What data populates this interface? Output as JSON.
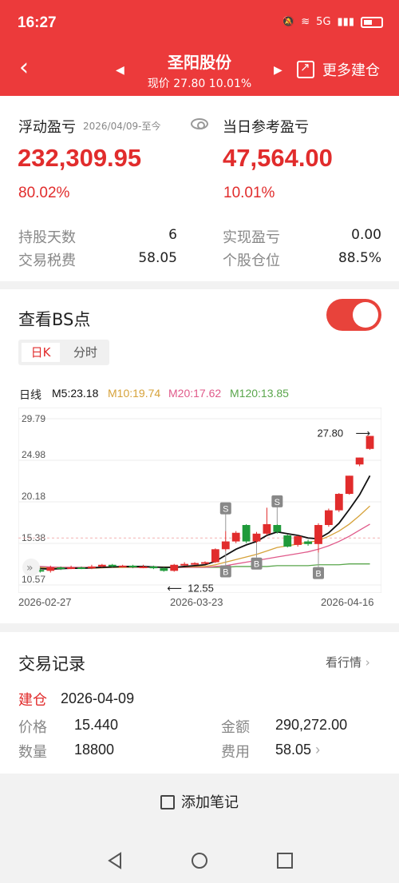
{
  "status_bar": {
    "time": "16:27",
    "network": "5G"
  },
  "header": {
    "title": "圣阳股份",
    "subtitle": "现价 27.80 10.01%",
    "more_label": "更多建仓"
  },
  "summary": {
    "float_label": "浮动盈亏",
    "float_date": "2026/04/09-至今",
    "float_value": "232,309.95",
    "float_pct": "80.02%",
    "day_label": "当日参考盈亏",
    "day_value": "47,564.00",
    "day_pct": "10.01%",
    "hold_days_label": "持股天数",
    "hold_days": "6",
    "realized_label": "实现盈亏",
    "realized": "0.00",
    "fee_label": "交易税费",
    "fee": "58.05",
    "position_label": "个股仓位",
    "position": "88.5%"
  },
  "bs": {
    "title": "查看BS点",
    "toggle_on": true,
    "tab_day": "日K",
    "tab_min": "分时",
    "ma_label": "日线",
    "ma5": "M5:23.18",
    "ma10": "M10:19.74",
    "ma20": "M20:17.62",
    "ma120": "M120:13.85",
    "colors": {
      "ma5": "#111111",
      "ma10": "#d6a23a",
      "ma20": "#e05a8a",
      "ma120": "#5aa64c",
      "up": "#e12c2c",
      "down": "#1f9a3a"
    }
  },
  "chart_data": {
    "type": "candlestick",
    "y_ticks": [
      "29.79",
      "24.98",
      "20.18",
      "15.38",
      "10.57"
    ],
    "ylim": [
      10.57,
      29.79
    ],
    "x_labels": [
      "2026-02-27",
      "2026-03-23",
      "2026-04-16"
    ],
    "high_annotation": "27.80",
    "low_annotation": "12.55",
    "candles": [
      {
        "o": 12.5,
        "c": 12.3,
        "h": 12.8,
        "l": 12.1
      },
      {
        "o": 12.3,
        "c": 12.2,
        "h": 12.5,
        "l": 12.0
      },
      {
        "o": 12.2,
        "c": 12.6,
        "h": 12.8,
        "l": 12.0
      },
      {
        "o": 12.6,
        "c": 12.5,
        "h": 12.7,
        "l": 12.3
      },
      {
        "o": 12.5,
        "c": 12.6,
        "h": 12.8,
        "l": 12.4
      },
      {
        "o": 12.6,
        "c": 12.5,
        "h": 12.7,
        "l": 12.4
      },
      {
        "o": 12.5,
        "c": 12.7,
        "h": 12.9,
        "l": 12.4
      },
      {
        "o": 12.7,
        "c": 12.9,
        "h": 13.0,
        "l": 12.6
      },
      {
        "o": 12.9,
        "c": 12.7,
        "h": 13.0,
        "l": 12.6
      },
      {
        "o": 12.7,
        "c": 12.8,
        "h": 12.9,
        "l": 12.6
      },
      {
        "o": 12.8,
        "c": 12.6,
        "h": 12.9,
        "l": 12.5
      },
      {
        "o": 12.6,
        "c": 12.7,
        "h": 12.9,
        "l": 12.5
      },
      {
        "o": 12.7,
        "c": 12.5,
        "h": 12.8,
        "l": 12.4
      },
      {
        "o": 12.5,
        "c": 12.2,
        "h": 12.6,
        "l": 12.1
      },
      {
        "o": 12.2,
        "c": 12.9,
        "h": 13.0,
        "l": 12.1
      },
      {
        "o": 12.9,
        "c": 13.0,
        "h": 13.2,
        "l": 12.8
      },
      {
        "o": 13.0,
        "c": 13.1,
        "h": 13.2,
        "l": 12.9
      },
      {
        "o": 13.1,
        "c": 13.2,
        "h": 13.3,
        "l": 13.0
      },
      {
        "o": 13.2,
        "c": 14.7,
        "h": 14.8,
        "l": 13.1
      },
      {
        "o": 14.7,
        "c": 15.6,
        "h": 16.8,
        "l": 14.5
      },
      {
        "o": 15.6,
        "c": 16.6,
        "h": 16.8,
        "l": 15.4
      },
      {
        "o": 17.5,
        "c": 15.6,
        "h": 17.6,
        "l": 15.4
      },
      {
        "o": 15.6,
        "c": 16.5,
        "h": 16.7,
        "l": 15.4
      },
      {
        "o": 16.5,
        "c": 17.6,
        "h": 19.5,
        "l": 16.3
      },
      {
        "o": 17.5,
        "c": 16.7,
        "h": 17.6,
        "l": 16.5
      },
      {
        "o": 16.3,
        "c": 15.0,
        "h": 16.4,
        "l": 14.9
      },
      {
        "o": 15.2,
        "c": 16.2,
        "h": 16.3,
        "l": 15.0
      },
      {
        "o": 15.6,
        "c": 15.3,
        "h": 15.8,
        "l": 15.1
      },
      {
        "o": 15.3,
        "c": 17.5,
        "h": 17.7,
        "l": 14.3
      },
      {
        "o": 17.5,
        "c": 19.2,
        "h": 19.4,
        "l": 17.3
      },
      {
        "o": 19.2,
        "c": 21.1,
        "h": 21.2,
        "l": 19.0
      },
      {
        "o": 21.1,
        "c": 23.2,
        "h": 23.2,
        "l": 21.0
      },
      {
        "o": 24.5,
        "c": 25.3,
        "h": 25.3,
        "l": 24.3
      },
      {
        "o": 26.3,
        "c": 27.8,
        "h": 27.8,
        "l": 26.2
      }
    ],
    "bs_marks": [
      {
        "type": "S",
        "index": 19,
        "label": "S"
      },
      {
        "type": "S",
        "index": 24,
        "label": "S"
      },
      {
        "type": "B",
        "index": 22,
        "label": "B"
      },
      {
        "type": "B",
        "index": 28,
        "label": "B"
      },
      {
        "type": "B",
        "index": 19,
        "label": "B"
      }
    ],
    "ma5": [
      12.5,
      12.45,
      12.4,
      12.45,
      12.5,
      12.5,
      12.55,
      12.6,
      12.65,
      12.7,
      12.7,
      12.7,
      12.65,
      12.6,
      12.6,
      12.7,
      12.8,
      12.9,
      13.3,
      14.0,
      14.7,
      15.2,
      15.6,
      16.3,
      16.7,
      16.5,
      16.3,
      16.0,
      15.9,
      16.6,
      17.7,
      19.3,
      21.0,
      23.2
    ],
    "ma10": [
      12.6,
      12.55,
      12.5,
      12.5,
      12.5,
      12.5,
      12.5,
      12.55,
      12.6,
      12.6,
      12.65,
      12.65,
      12.65,
      12.65,
      12.65,
      12.65,
      12.7,
      12.7,
      12.9,
      13.2,
      13.5,
      13.8,
      14.1,
      14.5,
      14.9,
      15.1,
      15.3,
      15.5,
      15.7,
      16.2,
      16.8,
      17.6,
      18.6,
      19.7
    ],
    "ma20": [
      12.7,
      12.7,
      12.65,
      12.6,
      12.6,
      12.6,
      12.6,
      12.6,
      12.6,
      12.6,
      12.6,
      12.6,
      12.6,
      12.6,
      12.6,
      12.6,
      12.6,
      12.6,
      12.7,
      12.8,
      13.0,
      13.2,
      13.4,
      13.6,
      13.8,
      14.0,
      14.2,
      14.4,
      14.7,
      15.1,
      15.6,
      16.2,
      16.9,
      17.6
    ],
    "ma120": [
      12.6,
      12.6,
      12.6,
      12.6,
      12.6,
      12.6,
      12.6,
      12.6,
      12.6,
      12.6,
      12.6,
      12.6,
      12.6,
      12.6,
      12.6,
      12.6,
      12.6,
      12.6,
      12.6,
      12.6,
      12.7,
      12.7,
      12.7,
      12.7,
      12.8,
      12.8,
      12.8,
      12.8,
      12.9,
      12.9,
      12.9,
      13.0,
      13.0,
      13.0
    ]
  },
  "records": {
    "title": "交易记录",
    "more_label": "看行情",
    "action": "建仓",
    "date": "2026-04-09",
    "price_label": "价格",
    "price": "15.440",
    "amount_label": "金额",
    "amount": "290,272.00",
    "qty_label": "数量",
    "qty": "18800",
    "fee_label": "费用",
    "fee": "58.05"
  },
  "add_note_label": "添加笔记"
}
